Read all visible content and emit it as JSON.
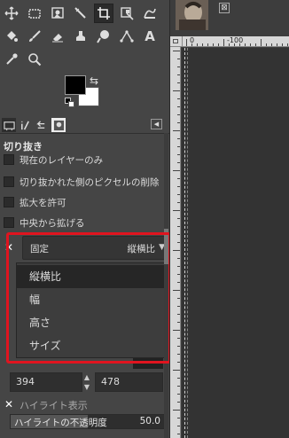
{
  "toolbox": {
    "tools": [
      {
        "name": "move-tool-icon"
      },
      {
        "name": "rect-select-tool-icon"
      },
      {
        "name": "fuzzy-select-tool-icon"
      },
      {
        "name": "magic-wand-tool-icon"
      },
      {
        "name": "crop-tool-icon",
        "active": true
      },
      {
        "name": "transform-tool-icon"
      },
      {
        "name": "warp-tool-icon"
      },
      {
        "name": "bucket-fill-tool-icon"
      },
      {
        "name": "paintbrush-tool-icon"
      },
      {
        "name": "eraser-tool-icon"
      },
      {
        "name": "clone-tool-icon"
      },
      {
        "name": "smudge-tool-icon"
      },
      {
        "name": "path-tool-icon"
      },
      {
        "name": "text-tool-icon"
      },
      {
        "name": "color-picker-tool-icon"
      },
      {
        "name": "zoom-tool-icon"
      }
    ],
    "text_tool_glyph": "A",
    "swap_glyph": "⇆"
  },
  "dock_tabs": [
    "tool-options-tab",
    "device-status-tab",
    "undo-history-tab",
    "images-tab"
  ],
  "tool_options": {
    "title": "切り抜き",
    "checkboxes": [
      {
        "label": "現在のレイヤーのみ",
        "checked": false
      },
      {
        "label": "切り抜かれた側のピクセルの削除",
        "checked": false
      },
      {
        "label": "拡大を許可",
        "checked": false
      },
      {
        "label": "中央から拡げる",
        "checked": false
      }
    ],
    "fixed_combo": {
      "label": "固定",
      "value": "縦横比"
    },
    "dropdown_options": [
      "縦横比",
      "幅",
      "高さ",
      "サイズ"
    ],
    "dropdown_selected_index": 0,
    "size_fields": {
      "width": "394",
      "height": "478"
    },
    "highlight": {
      "label": "ハイライト表示",
      "enabled": true
    },
    "opacity": {
      "label": "ハイライトの不透明度",
      "value": "50.0",
      "percent": 50
    }
  },
  "image_window": {
    "close_glyph": "⊠",
    "ruler_labels": [
      "0",
      "-100"
    ]
  },
  "colors": {
    "foreground": "#000000",
    "background": "#ffffff",
    "highlight_border": "#e0141f"
  }
}
